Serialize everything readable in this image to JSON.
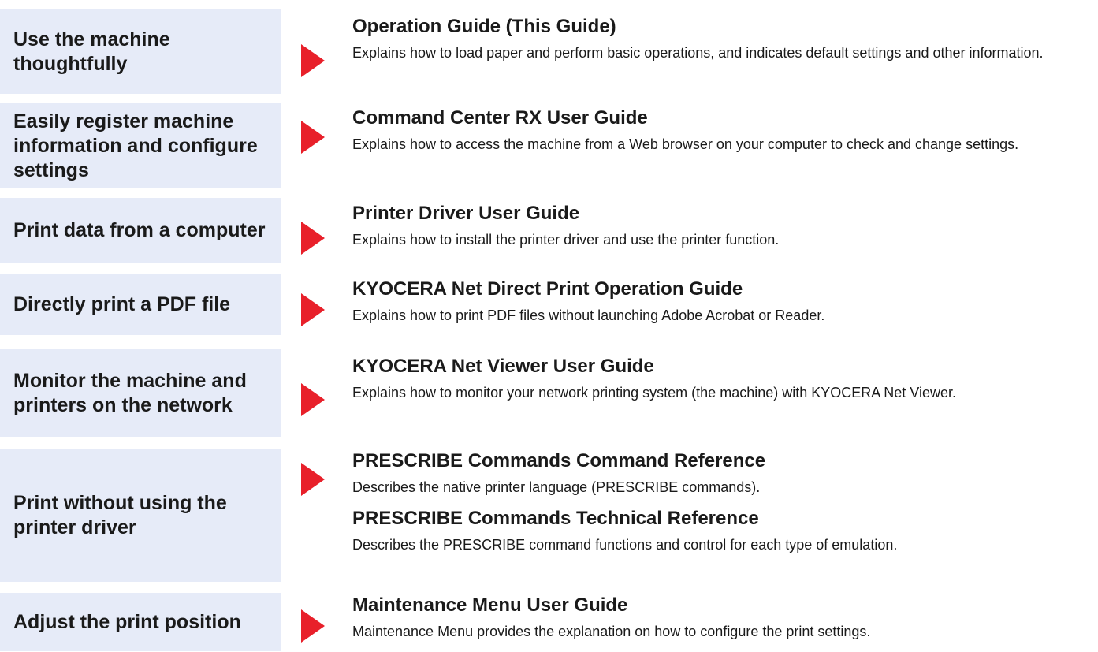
{
  "rows": [
    {
      "task": "Use the machine thoughtfully",
      "guides": [
        {
          "title": "Operation Guide (This Guide)",
          "desc": "Explains how to load paper and perform basic operations, and indicates default settings and other information."
        }
      ]
    },
    {
      "task": "Easily register machine information and configure settings",
      "guides": [
        {
          "title": "Command Center RX User Guide",
          "desc": "Explains how to access the machine from a Web browser on your computer to check and change settings."
        }
      ]
    },
    {
      "task": "Print data from a computer",
      "guides": [
        {
          "title": "Printer Driver User Guide",
          "desc": "Explains how to install the printer driver and use the printer function."
        }
      ]
    },
    {
      "task": "Directly print a PDF file",
      "guides": [
        {
          "title": "KYOCERA Net Direct Print Operation Guide",
          "desc": "Explains how to print PDF files without launching Adobe Acrobat or Reader."
        }
      ]
    },
    {
      "task": "Monitor the machine and printers on the network",
      "guides": [
        {
          "title": "KYOCERA Net Viewer User Guide",
          "desc": "Explains how to monitor your network printing system (the machine) with KYOCERA Net Viewer."
        }
      ]
    },
    {
      "task": "Print without using the printer driver",
      "guides": [
        {
          "title": "PRESCRIBE Commands Command Reference",
          "desc": "Describes the native printer language (PRESCRIBE commands)."
        },
        {
          "title": "PRESCRIBE Commands Technical Reference",
          "desc": "Describes the PRESCRIBE command functions and control for each type of emulation."
        }
      ]
    },
    {
      "task": "Adjust the print position",
      "guides": [
        {
          "title": "Maintenance Menu User Guide",
          "desc": "Maintenance Menu provides the explanation on how to configure the print settings."
        }
      ]
    }
  ],
  "colors": {
    "task_background": "#e6ebf8",
    "arrow": "#e8202a",
    "text": "#1a1a1a"
  },
  "icons": {
    "arrow": "right-pointing-triangle"
  }
}
